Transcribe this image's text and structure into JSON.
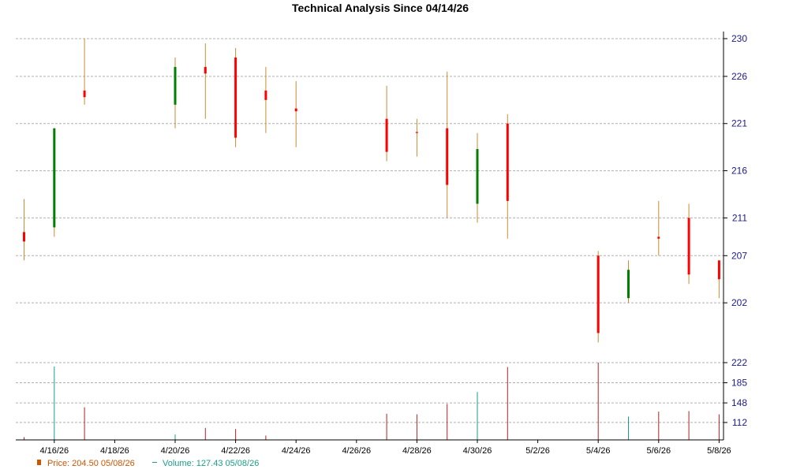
{
  "chart_data": {
    "type": "candlestick",
    "title": "Technical Analysis Since 04/14/26",
    "price_ticks": [
      202,
      207,
      211,
      216,
      221,
      226,
      230
    ],
    "volume_ticks": [
      112,
      148,
      185,
      222
    ],
    "price_range": [
      197,
      230
    ],
    "volume_range": [
      80,
      222
    ],
    "x_tick_labels": [
      {
        "date": "4/16/26",
        "day": 2
      },
      {
        "date": "4/18/26",
        "day": 4
      },
      {
        "date": "4/20/26",
        "day": 6
      },
      {
        "date": "4/22/26",
        "day": 8
      },
      {
        "date": "4/24/26",
        "day": 10
      },
      {
        "date": "4/26/26",
        "day": 12
      },
      {
        "date": "4/28/26",
        "day": 14
      },
      {
        "date": "4/30/26",
        "day": 16
      },
      {
        "date": "5/2/26",
        "day": 18
      },
      {
        "date": "5/4/26",
        "day": 20
      },
      {
        "date": "5/6/26",
        "day": 22
      },
      {
        "date": "5/8/26",
        "day": 24
      }
    ],
    "candles": [
      {
        "date": "4/15/26",
        "day": 1,
        "open": 209.5,
        "close": 208.5,
        "high": 213.0,
        "low": 206.5,
        "volume": 85
      },
      {
        "date": "4/16/26",
        "day": 2,
        "open": 210.0,
        "close": 220.5,
        "high": 220.5,
        "low": 209.0,
        "volume": 215
      },
      {
        "date": "4/17/26",
        "day": 3,
        "open": 224.5,
        "close": 223.8,
        "high": 230.0,
        "low": 223.0,
        "volume": 140
      },
      {
        "date": "4/20/26",
        "day": 6,
        "open": 223.0,
        "close": 227.0,
        "high": 228.0,
        "low": 220.5,
        "volume": 90
      },
      {
        "date": "4/21/26",
        "day": 7,
        "open": 227.0,
        "close": 226.3,
        "high": 229.5,
        "low": 221.5,
        "volume": 102
      },
      {
        "date": "4/22/26",
        "day": 8,
        "open": 228.0,
        "close": 219.5,
        "high": 229.0,
        "low": 218.5,
        "volume": 100
      },
      {
        "date": "4/23/26",
        "day": 9,
        "open": 224.5,
        "close": 223.5,
        "high": 227.0,
        "low": 220.0,
        "volume": 88
      },
      {
        "date": "4/24/26",
        "day": 10,
        "open": 222.6,
        "close": 222.3,
        "high": 225.5,
        "low": 218.5,
        "volume": 80
      },
      {
        "date": "4/27/26",
        "day": 13,
        "open": 221.5,
        "close": 218.0,
        "high": 225.0,
        "low": 217.0,
        "volume": 128
      },
      {
        "date": "4/28/26",
        "day": 14,
        "open": 220.1,
        "close": 220.0,
        "high": 221.5,
        "low": 217.5,
        "volume": 127
      },
      {
        "date": "4/29/26",
        "day": 15,
        "open": 220.5,
        "close": 214.5,
        "high": 226.5,
        "low": 211.0,
        "volume": 146
      },
      {
        "date": "4/30/26",
        "day": 16,
        "open": 212.5,
        "close": 218.3,
        "high": 220.0,
        "low": 210.5,
        "volume": 168
      },
      {
        "date": "5/1/26",
        "day": 17,
        "open": 221.0,
        "close": 212.8,
        "high": 222.0,
        "low": 208.8,
        "volume": 214
      },
      {
        "date": "5/4/26",
        "day": 20,
        "open": 207.0,
        "close": 198.8,
        "high": 207.5,
        "low": 197.8,
        "volume": 222
      },
      {
        "date": "5/5/26",
        "day": 21,
        "open": 202.5,
        "close": 205.5,
        "high": 206.5,
        "low": 202.0,
        "volume": 123
      },
      {
        "date": "5/6/26",
        "day": 22,
        "open": 209.0,
        "close": 208.8,
        "high": 212.8,
        "low": 207.0,
        "volume": 132
      },
      {
        "date": "5/7/26",
        "day": 23,
        "open": 211.0,
        "close": 205.0,
        "high": 212.5,
        "low": 204.0,
        "volume": 133
      },
      {
        "date": "5/8/26",
        "day": 24,
        "open": 206.5,
        "close": 204.5,
        "high": 206.5,
        "low": 202.5,
        "volume": 127
      }
    ],
    "colors": {
      "up": "#008000",
      "down": "#ff0000",
      "wick": "#cc8a33",
      "volume_down": "#b22222",
      "volume_up": "#1a9e8a",
      "grid": "#b0b0b0",
      "axis_tick_text": "#1a1a8c"
    },
    "legend": {
      "price_label": "Price: 204.50  05/08/26",
      "volume_label": "Volume: 127.43  05/08/26",
      "price_color": "#cc5500",
      "volume_color": "#1a9e8a"
    }
  }
}
